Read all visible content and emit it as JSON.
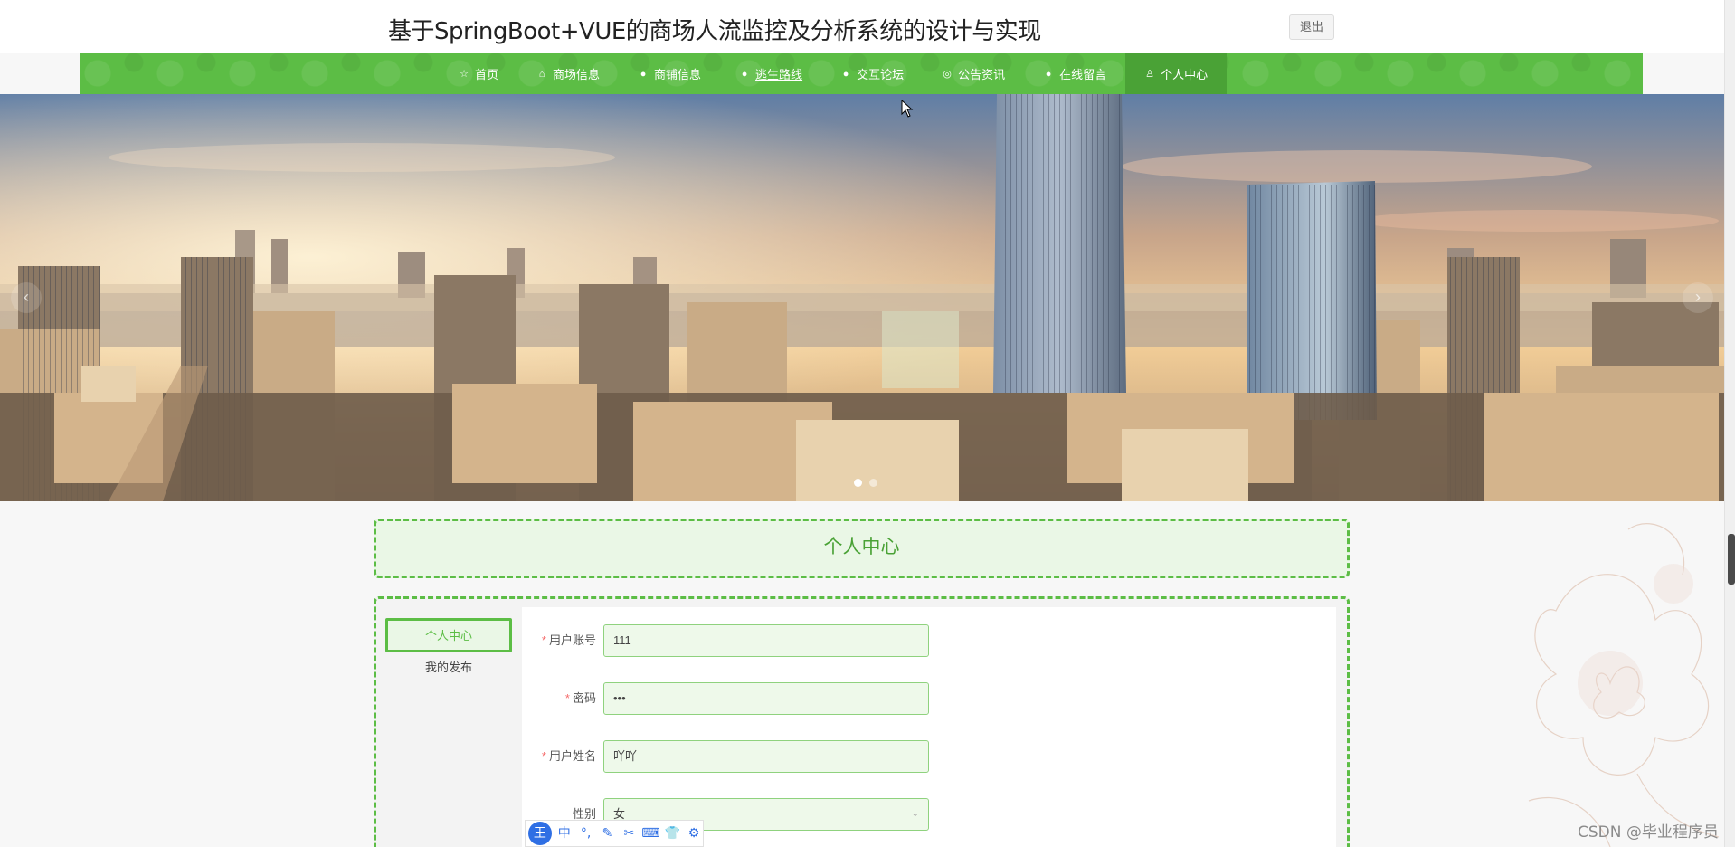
{
  "header": {
    "title": "基于SpringBoot+VUE的商场人流监控及分析系统的设计与实现",
    "logout_label": "退出"
  },
  "nav": {
    "items": [
      {
        "label": "首页",
        "icon": "star-icon"
      },
      {
        "label": "商场信息",
        "icon": "home-icon"
      },
      {
        "label": "商铺信息",
        "icon": "info-icon"
      },
      {
        "label": "逃生路线",
        "icon": "info-icon"
      },
      {
        "label": "交互论坛",
        "icon": "info-icon"
      },
      {
        "label": "公告资讯",
        "icon": "globe-icon"
      },
      {
        "label": "在线留言",
        "icon": "info-icon"
      },
      {
        "label": "个人中心",
        "icon": "user-icon"
      }
    ],
    "active_index": 7,
    "accent": "#5cbd45"
  },
  "banner": {
    "arrow_prev": "‹",
    "arrow_next": "›",
    "slide_count": 2,
    "active_slide": 0
  },
  "page": {
    "title": "个人中心"
  },
  "side_menu": {
    "items": [
      {
        "label": "个人中心"
      },
      {
        "label": "我的发布"
      }
    ],
    "active_index": 0
  },
  "form": {
    "required_mark": "*",
    "fields": [
      {
        "label": "用户账号",
        "value": "111",
        "required": true,
        "type": "text"
      },
      {
        "label": "密码",
        "value": "•••",
        "required": true,
        "type": "password"
      },
      {
        "label": "用户姓名",
        "value": "吖吖",
        "required": true,
        "type": "text"
      },
      {
        "label": "性别",
        "value": "女",
        "required": false,
        "type": "select"
      }
    ]
  },
  "ime_toolbar": {
    "logo": "王",
    "buttons": [
      "中",
      "°,",
      "✎",
      "✂",
      "⌨",
      "👕",
      "⚙"
    ]
  },
  "watermark": "CSDN @毕业程序员"
}
